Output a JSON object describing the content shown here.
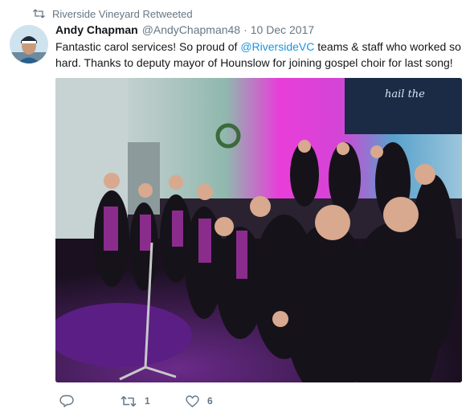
{
  "social_context": {
    "icon": "retweet-icon",
    "text": "Riverside Vineyard Retweeted"
  },
  "tweet": {
    "author_name": "Andy Chapman",
    "author_handle": "@AndyChapman48",
    "separator": "·",
    "date": "10 Dec 2017",
    "text_part1": "Fantastic carol services! So proud of ",
    "mention": "@RiversideVC",
    "text_part2": " teams & staff who worked so hard. Thanks to deputy mayor of Hounslow for joining gospel choir for last song!",
    "photo_banner_text": "hail the"
  },
  "actions": {
    "reply": {
      "icon": "reply-icon",
      "count": ""
    },
    "retweet": {
      "icon": "retweet-icon",
      "count": "1"
    },
    "like": {
      "icon": "heart-icon",
      "count": "6"
    }
  },
  "colors": {
    "link": "#1b95e0",
    "muted": "#657786",
    "text": "#14171a"
  }
}
